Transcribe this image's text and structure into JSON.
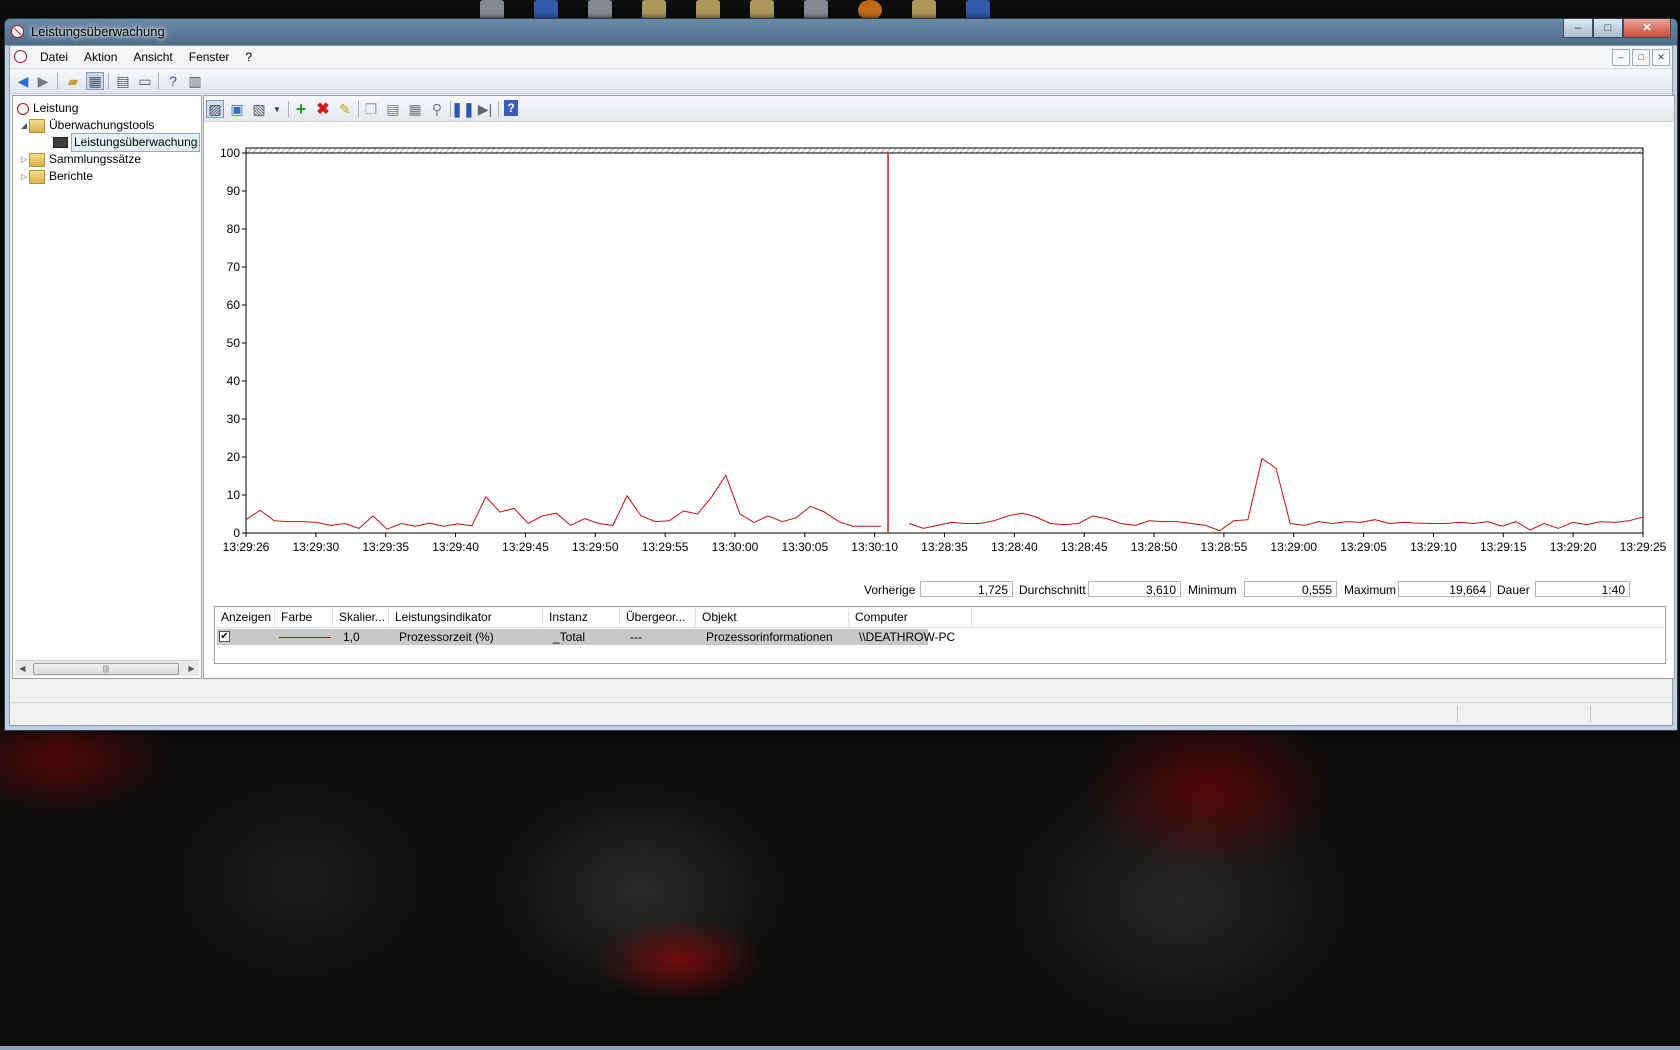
{
  "window": {
    "title": "Leistungsüberwachung"
  },
  "window_buttons": {
    "minimize": "–",
    "maximize": "□",
    "close": "✕"
  },
  "menu": {
    "items": [
      "Datei",
      "Aktion",
      "Ansicht",
      "Fenster",
      "?"
    ]
  },
  "tree": {
    "root": "Leistung",
    "tools": "Überwachungstools",
    "monitor": "Leistungsüberwachung",
    "collector_sets": "Sammlungssätze",
    "reports": "Berichte"
  },
  "chart_data": {
    "type": "line",
    "ylim": [
      0,
      100
    ],
    "y_ticks": [
      0,
      10,
      20,
      30,
      40,
      50,
      60,
      70,
      80,
      90,
      100
    ],
    "x_tick_labels": [
      "13:29:26",
      "13:29:30",
      "13:29:35",
      "13:29:40",
      "13:29:45",
      "13:29:50",
      "13:29:55",
      "13:30:00",
      "13:30:05",
      "13:30:10",
      "13:28:35",
      "13:28:40",
      "13:28:45",
      "13:28:50",
      "13:28:55",
      "13:29:00",
      "13:29:05",
      "13:29:10",
      "13:29:15",
      "13:29:20",
      "13:29:25"
    ],
    "samples_total": 100,
    "current_index": 45,
    "series": [
      {
        "name": "Prozessorzeit (%)",
        "color": "#c81010",
        "values": [
          3.5,
          6,
          3.2,
          3,
          3,
          2.8,
          2,
          2.5,
          1.2,
          4.5,
          1,
          2.5,
          1.8,
          2.6,
          1.8,
          2.4,
          1.9,
          9.5,
          5.5,
          6.5,
          2.5,
          4.5,
          5.2,
          2,
          3.8,
          2.5,
          2,
          9.8,
          4.5,
          3,
          3.2,
          5.8,
          5,
          9.5,
          15.2,
          5,
          2.8,
          4.5,
          3,
          4,
          7,
          5.5,
          3,
          1.8,
          1.8,
          1.8,
          null,
          2.5,
          1.2,
          2,
          2.8,
          2.5,
          2.5,
          3.2,
          4.5,
          5.2,
          4.2,
          2.5,
          2.2,
          2.5,
          4.5,
          3.8,
          2.5,
          2,
          3.2,
          3,
          3,
          2.5,
          2,
          0.6,
          3.2,
          3.5,
          19.6,
          17,
          2.5,
          2,
          3,
          2.5,
          3,
          2.8,
          3.5,
          2.5,
          2.8,
          2.6,
          2.5,
          2.5,
          2.8,
          2.5,
          3,
          1.8,
          3,
          0.8,
          2.5,
          1.2,
          2.8,
          2.2,
          3,
          2.8,
          3.2,
          4.2
        ]
      }
    ]
  },
  "stats": {
    "previous_label": "Vorherige",
    "previous_value": "1,725",
    "average_label": "Durchschnitt",
    "average_value": "3,610",
    "min_label": "Minimum",
    "min_value": "0,555",
    "max_label": "Maximum",
    "max_value": "19,664",
    "duration_label": "Dauer",
    "duration_value": "1:40"
  },
  "counter_table": {
    "columns": [
      "Anzeigen",
      "Farbe",
      "Skalier...",
      "Leistungsindikator",
      "Instanz",
      "Übergeor...",
      "Objekt",
      "Computer"
    ],
    "rows": [
      {
        "checked": "✔",
        "scale": "1,0",
        "counter": "Prozessorzeit (%)",
        "instance": "_Total",
        "parent": "---",
        "object": "Prozessorinformationen",
        "computer": "\\\\DEATHROW-PC"
      }
    ]
  }
}
